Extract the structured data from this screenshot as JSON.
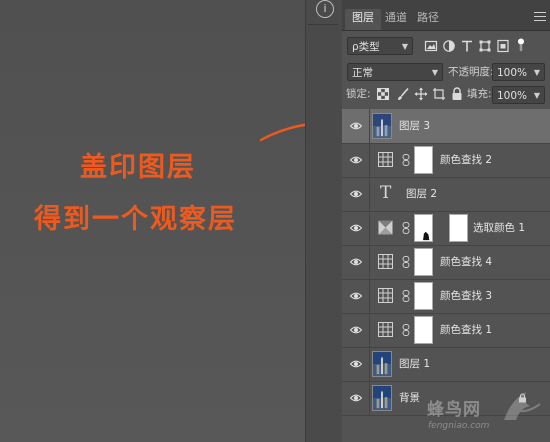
{
  "annotation": {
    "line1": "盖印图层",
    "line2": "得到一个观察层",
    "color": "#ec5a1f"
  },
  "thin_toolbar": {
    "info_icon": "i"
  },
  "panel": {
    "tabs": [
      {
        "label": "图层",
        "active": true
      },
      {
        "label": "通道",
        "active": false
      },
      {
        "label": "路径",
        "active": false
      }
    ],
    "filter": {
      "value": "ρ类型",
      "icons": [
        "image-filter-icon",
        "adjustment-filter-icon",
        "type-filter-icon",
        "shape-filter-icon",
        "smart-object-filter-icon",
        "toggle-filter-icon"
      ]
    },
    "blend_mode": "正常",
    "opacity_label": "不透明度:",
    "opacity_value": "100%",
    "lock_label": "锁定:",
    "fill_label": "填充:",
    "fill_value": "100%",
    "layers": [
      {
        "name": "图层 3",
        "type": "pixel",
        "selected": true
      },
      {
        "name": "颜色查找 2",
        "type": "adjustment-lookup",
        "selected": false
      },
      {
        "name": "图层 2",
        "type": "text",
        "selected": false
      },
      {
        "name": "选取颜色 1",
        "type": "adjustment-selective",
        "selected": false
      },
      {
        "name": "颜色查找 4",
        "type": "adjustment-lookup",
        "selected": false
      },
      {
        "name": "颜色查找 3",
        "type": "adjustment-lookup",
        "selected": false
      },
      {
        "name": "颜色查找 1",
        "type": "adjustment-lookup",
        "selected": false
      },
      {
        "name": "图层 1",
        "type": "pixel",
        "selected": false
      },
      {
        "name": "背景",
        "type": "background",
        "selected": false
      }
    ]
  },
  "watermark": {
    "main": "蜂鸟网",
    "sub": "fengniao.com"
  }
}
